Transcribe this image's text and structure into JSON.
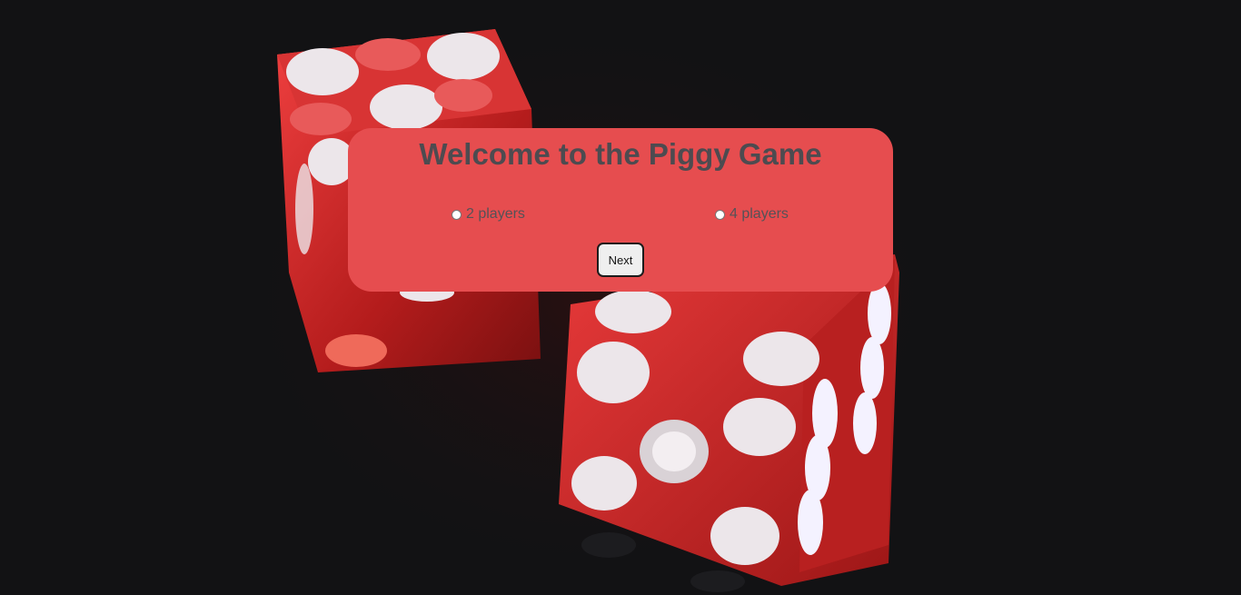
{
  "title": "Welcome to the Piggy Game",
  "options": [
    {
      "label": "2 players",
      "checked": false
    },
    {
      "label": "4 players",
      "checked": false
    }
  ],
  "next_label": "Next",
  "colors": {
    "background": "#121214",
    "panel": "#e64d4f",
    "title_text": "#4d4b50",
    "dice_red": "#d22a2a",
    "pip": "#ece6ea"
  }
}
